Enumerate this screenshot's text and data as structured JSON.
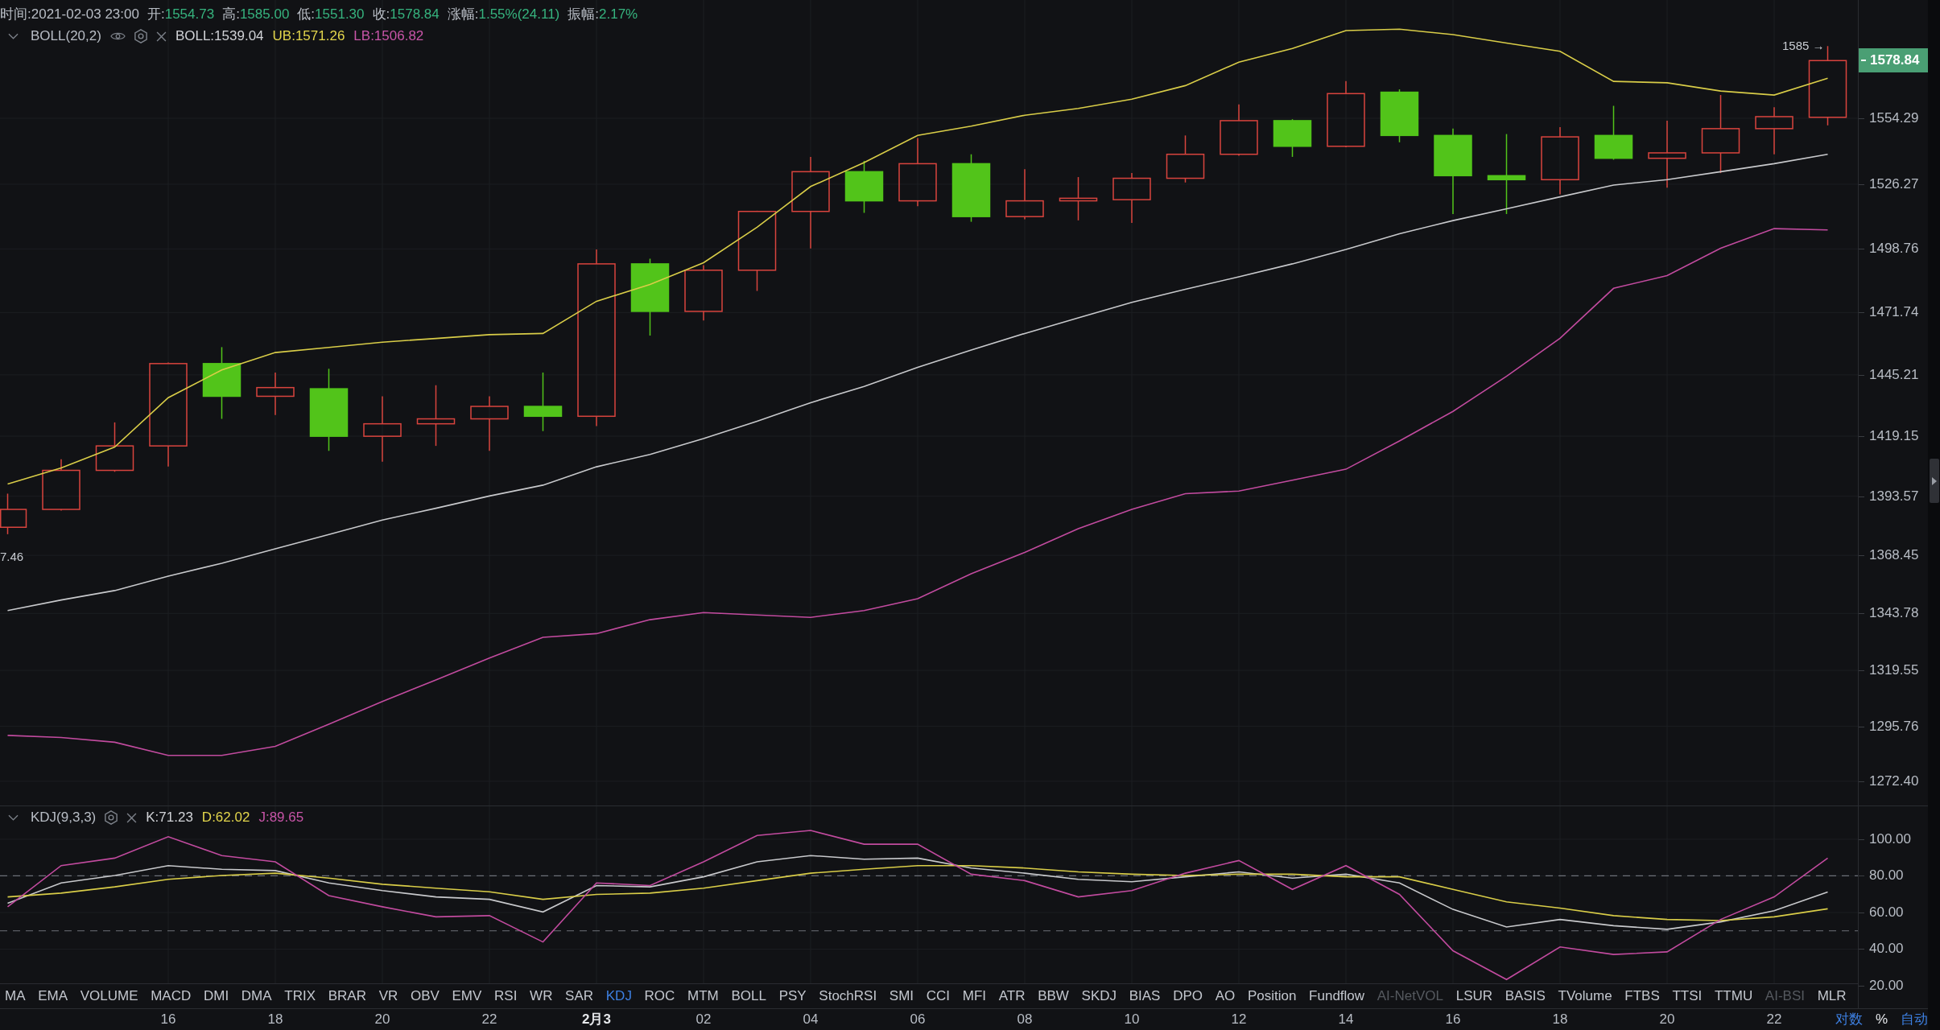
{
  "quote_header": {
    "rising": true,
    "items": [
      {
        "kind": "time",
        "label": "时间:",
        "value": "2021-02-03 23:00"
      },
      {
        "kind": "price",
        "label": "开:",
        "value": "1554.73"
      },
      {
        "kind": "price",
        "label": "高:",
        "value": "1585.00"
      },
      {
        "kind": "price",
        "label": "低:",
        "value": "1551.30"
      },
      {
        "kind": "price",
        "label": "收:",
        "value": "1578.84"
      },
      {
        "kind": "price",
        "label": "涨幅:",
        "value": "1.55%(24.11)"
      },
      {
        "kind": "price",
        "label": "振幅:",
        "value": "2.17%"
      }
    ]
  },
  "main_chart": {
    "legend": {
      "name": "BOLL(20,2)",
      "expanded": true,
      "visibility_toggle": true,
      "values": [
        {
          "text": "BOLL:1539.04",
          "color": "#d0d2d6"
        },
        {
          "text": "UB:1571.26",
          "color": "#e3d64c"
        },
        {
          "text": "LB:1506.82",
          "color": "#c855a8"
        }
      ]
    },
    "high_marker": "1585 →",
    "low_marker": "7.46",
    "price_tag": "1578.84",
    "chart_data": {
      "type": "line",
      "grid": true,
      "ylim": [
        1262.1,
        1604.6
      ],
      "yticks": [
        {
          "value": 1272.4,
          "label": "1272.40"
        },
        {
          "value": 1295.76,
          "label": "1295.76"
        },
        {
          "value": 1319.55,
          "label": "1319.55"
        },
        {
          "value": 1343.78,
          "label": "1343.78"
        },
        {
          "value": 1368.45,
          "label": "1368.45"
        },
        {
          "value": 1393.57,
          "label": "1393.57"
        },
        {
          "value": 1419.15,
          "label": "1419.15"
        },
        {
          "value": 1445.21,
          "label": "1445.21"
        },
        {
          "value": 1471.74,
          "label": "1471.74"
        },
        {
          "value": 1498.76,
          "label": "1498.76"
        },
        {
          "value": 1526.27,
          "label": "1526.27"
        },
        {
          "value": 1554.29,
          "label": "1554.29"
        }
      ],
      "series": [
        {
          "color": "#d9cd48",
          "values": [
            1398.8,
            1405.6,
            1414.5,
            1435.5,
            1447.3,
            1454.7,
            1456.9,
            1459.1,
            1460.7,
            1462.3,
            1462.8,
            1476.5,
            1483.6,
            1492.9,
            1508.0,
            1525.3,
            1535.5,
            1547.0,
            1551.0,
            1555.6,
            1558.5,
            1562.4,
            1568.2,
            1578.2,
            1584.0,
            1591.6,
            1592.2,
            1589.9,
            1586.3,
            1582.8,
            1570.0,
            1569.4,
            1565.9,
            1564.2,
            1571.3
          ]
        },
        {
          "color": "#c8c9cc",
          "values": [
            1345.0,
            1349.5,
            1353.5,
            1359.6,
            1365.1,
            1371.2,
            1377.3,
            1383.5,
            1388.5,
            1393.7,
            1398.3,
            1406.1,
            1411.4,
            1418.1,
            1425.5,
            1433.4,
            1440.3,
            1448.4,
            1455.8,
            1462.8,
            1469.4,
            1476.0,
            1481.6,
            1486.9,
            1492.4,
            1498.5,
            1505.2,
            1510.8,
            1515.8,
            1520.9,
            1525.9,
            1528.2,
            1531.6,
            1535.0,
            1539.0
          ]
        },
        {
          "color": "#c24b9f",
          "values": [
            1291.9,
            1291.0,
            1289.0,
            1283.4,
            1283.4,
            1287.2,
            1296.7,
            1306.3,
            1315.5,
            1324.8,
            1333.6,
            1335.2,
            1341.1,
            1344.1,
            1343.1,
            1342.1,
            1345.0,
            1350.0,
            1360.6,
            1369.7,
            1379.8,
            1388.0,
            1394.7,
            1395.8,
            1400.4,
            1405.1,
            1417.1,
            1429.7,
            1444.6,
            1460.8,
            1482.0,
            1487.4,
            1499.0,
            1507.4,
            1506.8
          ]
        }
      ]
    }
  },
  "oscillator_chart": {
    "legend": {
      "name": "KDJ(9,3,3)",
      "expanded": true,
      "values": [
        {
          "text": "K:71.23",
          "color": "#d0d2d6"
        },
        {
          "text": "D:62.02",
          "color": "#e3d64c"
        },
        {
          "text": "J:89.65",
          "color": "#c855a8"
        }
      ]
    },
    "chart_data": {
      "type": "line",
      "grid": true,
      "ylim": [
        7.7,
        118.0
      ],
      "yticks": [
        {
          "value": 20,
          "label": "20.00"
        },
        {
          "value": 40,
          "label": "40.00"
        },
        {
          "value": 60,
          "label": "60.00"
        },
        {
          "value": 80,
          "label": "80.00"
        },
        {
          "value": 100,
          "label": "100.00"
        }
      ],
      "ref_lines": [
        {
          "axis": "y",
          "value": 80
        },
        {
          "axis": "y",
          "value": 50
        }
      ],
      "series": [
        {
          "color": "#c8c9cc",
          "values": [
            65.1,
            76.1,
            80.2,
            85.6,
            83.6,
            82.9,
            76.1,
            72.0,
            68.5,
            67.2,
            60.3,
            74.7,
            74.0,
            79.5,
            87.7,
            91.1,
            89.1,
            89.7,
            84.3,
            81.5,
            78.1,
            76.8,
            79.5,
            82.2,
            78.8,
            80.9,
            76.1,
            61.7,
            52.1,
            56.2,
            52.8,
            50.8,
            54.9,
            61.0,
            71.2
          ]
        },
        {
          "color": "#d9cd48",
          "values": [
            68.5,
            70.6,
            74.0,
            78.1,
            80.2,
            81.5,
            78.8,
            75.4,
            73.3,
            71.3,
            67.2,
            69.9,
            70.6,
            73.3,
            77.4,
            81.5,
            83.6,
            85.6,
            85.6,
            84.3,
            82.2,
            80.9,
            80.2,
            80.9,
            80.9,
            79.5,
            79.5,
            72.6,
            65.8,
            62.4,
            58.3,
            56.2,
            55.6,
            57.6,
            62.0
          ]
        },
        {
          "color": "#c24b9f",
          "values": [
            63.1,
            85.6,
            89.7,
            101.4,
            91.1,
            87.7,
            69.2,
            63.1,
            57.6,
            58.3,
            43.9,
            76.1,
            74.7,
            87.7,
            102.1,
            104.8,
            97.3,
            97.3,
            80.9,
            77.4,
            68.5,
            72.0,
            81.5,
            88.4,
            72.6,
            85.6,
            69.9,
            39.1,
            23.4,
            41.2,
            37.1,
            38.5,
            56.2,
            68.5,
            89.7
          ]
        }
      ]
    }
  },
  "indicator_bar": {
    "items": [
      {
        "label": "MA",
        "selected": false,
        "disabled": false
      },
      {
        "label": "EMA",
        "selected": false,
        "disabled": false
      },
      {
        "label": "VOLUME",
        "selected": false,
        "disabled": false
      },
      {
        "label": "MACD",
        "selected": false,
        "disabled": false
      },
      {
        "label": "DMI",
        "selected": false,
        "disabled": false
      },
      {
        "label": "DMA",
        "selected": false,
        "disabled": false
      },
      {
        "label": "TRIX",
        "selected": false,
        "disabled": false
      },
      {
        "label": "BRAR",
        "selected": false,
        "disabled": false
      },
      {
        "label": "VR",
        "selected": false,
        "disabled": false
      },
      {
        "label": "OBV",
        "selected": false,
        "disabled": false
      },
      {
        "label": "EMV",
        "selected": false,
        "disabled": false
      },
      {
        "label": "RSI",
        "selected": false,
        "disabled": false
      },
      {
        "label": "WR",
        "selected": false,
        "disabled": false
      },
      {
        "label": "SAR",
        "selected": false,
        "disabled": false
      },
      {
        "label": "KDJ",
        "selected": true,
        "disabled": false
      },
      {
        "label": "ROC",
        "selected": false,
        "disabled": false
      },
      {
        "label": "MTM",
        "selected": false,
        "disabled": false
      },
      {
        "label": "BOLL",
        "selected": false,
        "disabled": false
      },
      {
        "label": "PSY",
        "selected": false,
        "disabled": false
      },
      {
        "label": "StochRSI",
        "selected": false,
        "disabled": false
      },
      {
        "label": "SMI",
        "selected": false,
        "disabled": false
      },
      {
        "label": "CCI",
        "selected": false,
        "disabled": false
      },
      {
        "label": "MFI",
        "selected": false,
        "disabled": false
      },
      {
        "label": "ATR",
        "selected": false,
        "disabled": false
      },
      {
        "label": "BBW",
        "selected": false,
        "disabled": false
      },
      {
        "label": "SKDJ",
        "selected": false,
        "disabled": false
      },
      {
        "label": "BIAS",
        "selected": false,
        "disabled": false
      },
      {
        "label": "DPO",
        "selected": false,
        "disabled": false
      },
      {
        "label": "AO",
        "selected": false,
        "disabled": false
      },
      {
        "label": "Position",
        "selected": false,
        "disabled": false
      },
      {
        "label": "Fundflow",
        "selected": false,
        "disabled": false
      },
      {
        "label": "AI-NetVOL",
        "selected": false,
        "disabled": true
      },
      {
        "label": "LSUR",
        "selected": false,
        "disabled": false
      },
      {
        "label": "BASIS",
        "selected": false,
        "disabled": false
      },
      {
        "label": "TVolume",
        "selected": false,
        "disabled": false
      },
      {
        "label": "FTBS",
        "selected": false,
        "disabled": false
      },
      {
        "label": "TTSI",
        "selected": false,
        "disabled": false
      },
      {
        "label": "TTMU",
        "selected": false,
        "disabled": false
      },
      {
        "label": "AI-BSI",
        "selected": false,
        "disabled": true
      },
      {
        "label": "MLR",
        "selected": false,
        "disabled": false
      }
    ]
  },
  "time_axis": [
    {
      "label": "16",
      "kind": "hour"
    },
    {
      "label": "18",
      "kind": "hour"
    },
    {
      "label": "20",
      "kind": "hour"
    },
    {
      "label": "22",
      "kind": "hour"
    },
    {
      "label": "2月3",
      "kind": "date"
    },
    {
      "label": "02",
      "kind": "hour"
    },
    {
      "label": "04",
      "kind": "hour"
    },
    {
      "label": "06",
      "kind": "hour"
    },
    {
      "label": "08",
      "kind": "hour"
    },
    {
      "label": "10",
      "kind": "hour"
    },
    {
      "label": "12",
      "kind": "hour"
    },
    {
      "label": "14",
      "kind": "hour"
    },
    {
      "label": "16",
      "kind": "hour"
    },
    {
      "label": "18",
      "kind": "hour"
    },
    {
      "label": "20",
      "kind": "hour"
    },
    {
      "label": "22",
      "kind": "hour"
    }
  ],
  "scale_buttons": [
    {
      "label": "对数",
      "on": true
    },
    {
      "label": "%",
      "on": false
    },
    {
      "label": "自动",
      "on": true
    }
  ]
}
